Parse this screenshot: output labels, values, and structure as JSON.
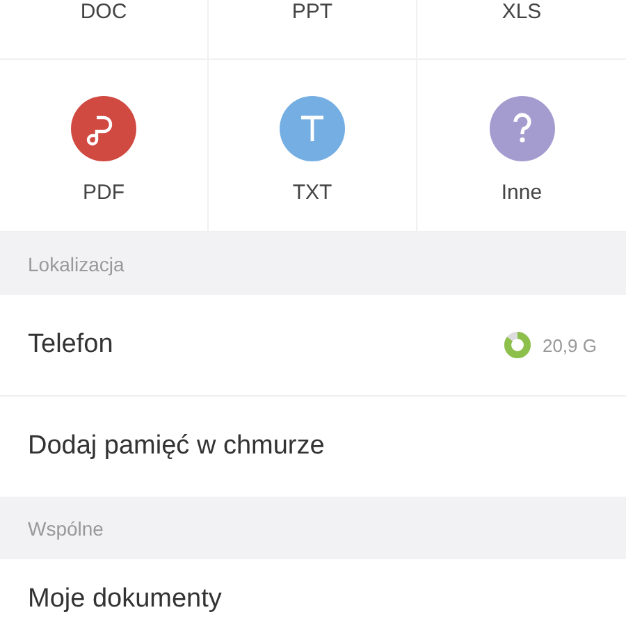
{
  "file_types_top": [
    {
      "label": "DOC"
    },
    {
      "label": "PPT"
    },
    {
      "label": "XLS"
    }
  ],
  "file_types": [
    {
      "label": "PDF",
      "kind": "pdf",
      "color": "#d04a42"
    },
    {
      "label": "TXT",
      "kind": "txt",
      "color": "#74aee3"
    },
    {
      "label": "Inne",
      "kind": "other",
      "color": "#a49ccf"
    }
  ],
  "sections": [
    {
      "header": "Lokalizacja",
      "items": [
        {
          "label": "Telefon",
          "storage": {
            "level": 0.85,
            "reading": "20,9 G"
          }
        },
        {
          "label": "Dodaj pamięć w chmurze"
        }
      ]
    },
    {
      "header": "Wspólne",
      "items": [
        {
          "label": "Moje dokumenty"
        }
      ]
    }
  ]
}
